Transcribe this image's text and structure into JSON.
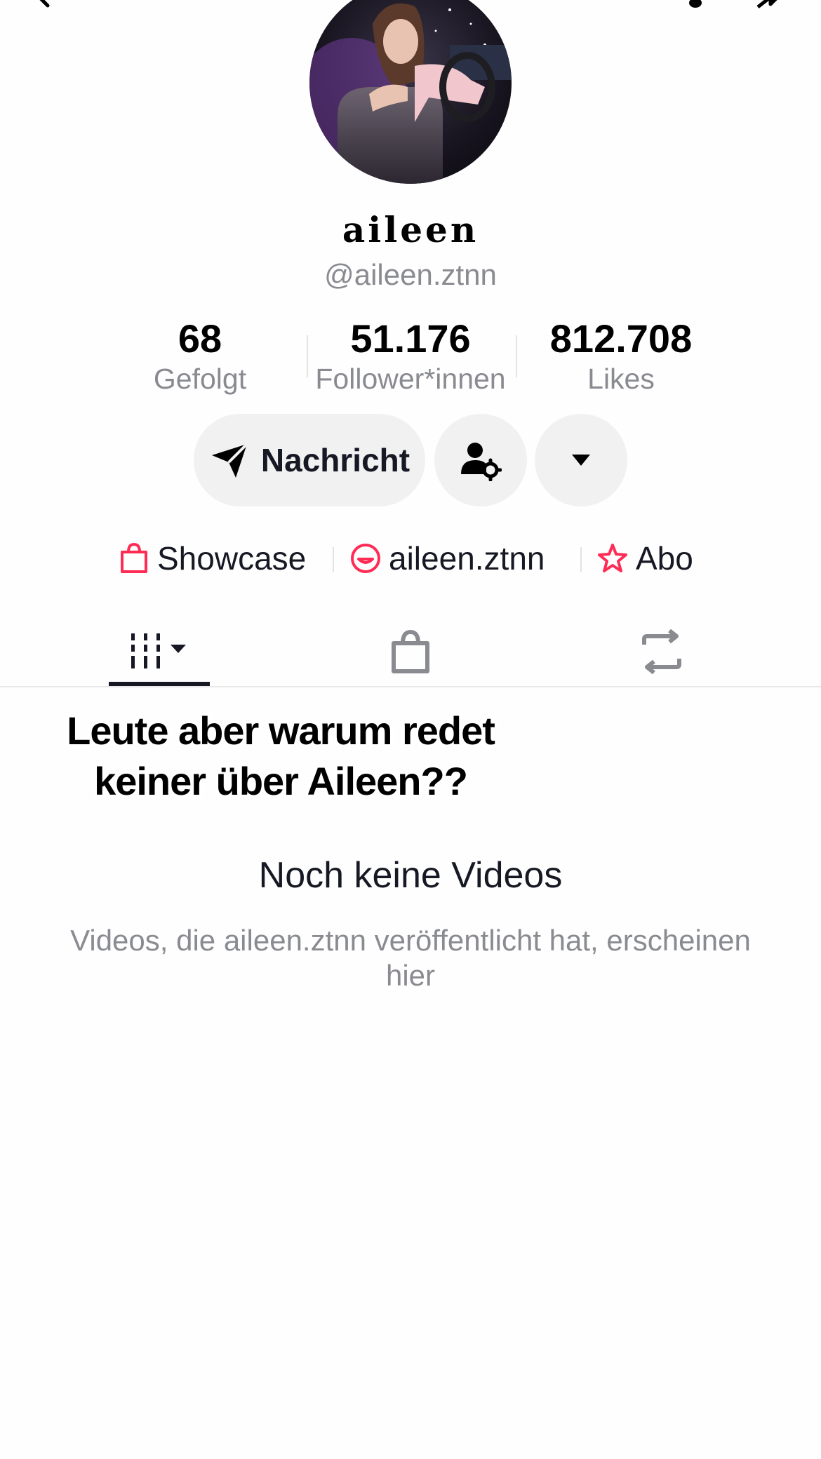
{
  "profile": {
    "display_name": "aileen",
    "handle": "@aileen.ztnn"
  },
  "stats": [
    {
      "value": "68",
      "label": "Gefolgt"
    },
    {
      "value": "51.176",
      "label": "Follower*innen"
    },
    {
      "value": "812.708",
      "label": "Likes"
    }
  ],
  "actions": {
    "message_label": "Nachricht"
  },
  "links": {
    "showcase": "Showcase",
    "instagram": "aileen.ztnn",
    "abo": "Abo"
  },
  "overlay": {
    "line1": "Leute aber warum redet",
    "line2": "keiner über Aileen??"
  },
  "empty_state": {
    "title": "Noch keine Videos",
    "description": "Videos, die aileen.ztnn veröffentlicht hat, erscheinen hier"
  },
  "colors": {
    "accent": "#fe2c55",
    "text_primary": "#161823",
    "text_secondary": "#8a8b91",
    "button_bg": "#f1f1f2"
  }
}
